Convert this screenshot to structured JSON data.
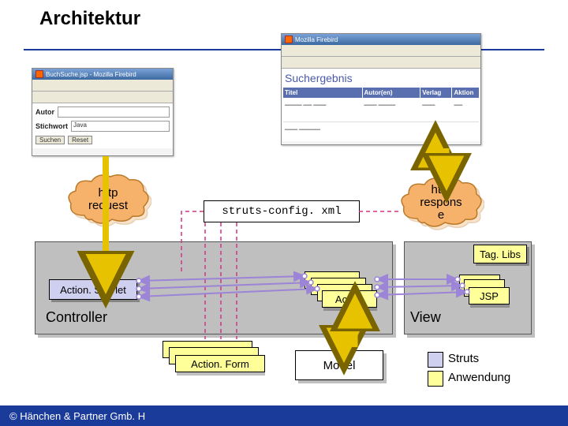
{
  "title": "Architektur",
  "screenshots": {
    "left": {
      "titlebar": "BuchSuche.jsp - Mozilla Firebird",
      "field_autor": "Autor",
      "field_stichwort": "Stichwort",
      "input_value": "Java",
      "btn_search": "Suchen",
      "btn_reset": "Reset"
    },
    "right": {
      "titlebar": "Mozilla Firebird",
      "heading": "Suchergebnis",
      "cols": {
        "titel": "Titel",
        "autor": "Autor(en)",
        "verlag": "Verlag",
        "aktion": "Aktion"
      }
    }
  },
  "clouds": {
    "request": "http\nrequest",
    "response": "http\nrespons\ne"
  },
  "config_file": "struts-config. xml",
  "boxes": {
    "taglibs": "Tag. Libs",
    "actionservlet": "Action. Servlet",
    "action": "Action",
    "actionform": "Action. Form",
    "jsp": "JSP",
    "controller": "Controller",
    "view": "View",
    "model": "Model"
  },
  "legend": {
    "struts": "Struts",
    "anwendung": "Anwendung"
  },
  "footer": "© Hänchen & Partner Gmb. H",
  "colors": {
    "lavender": "#cfcff0",
    "yellow": "#ffff99",
    "cloud": "#f6b26b"
  }
}
